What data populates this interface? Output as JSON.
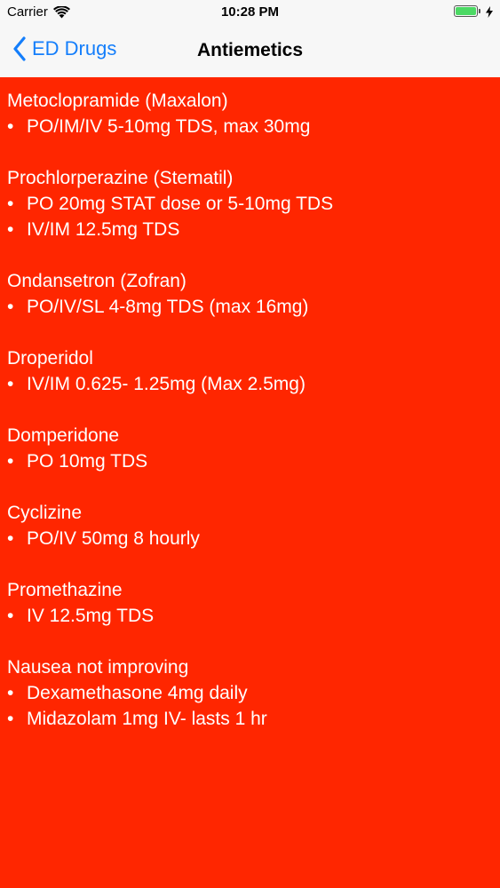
{
  "status_bar": {
    "carrier": "Carrier",
    "time": "10:28 PM",
    "wifi_icon": "wifi-icon",
    "battery_icon": "battery-icon",
    "charging_icon": "bolt-icon",
    "battery_level": 1.0,
    "battery_color": "#4cd964"
  },
  "nav": {
    "back_label": "ED Drugs",
    "back_icon": "chevron-left-icon",
    "title": "Antiemetics",
    "tint_color": "#147efb"
  },
  "background_color": "#ff2600",
  "sections": [
    {
      "name": "Metoclopramide (Maxalon)",
      "doses": [
        "PO/IM/IV 5-10mg TDS, max 30mg"
      ]
    },
    {
      "name": "Prochlorperazine (Stematil)",
      "doses": [
        "PO 20mg STAT dose or 5-10mg TDS",
        "IV/IM 12.5mg TDS"
      ]
    },
    {
      "name": "Ondansetron (Zofran)",
      "doses": [
        "PO/IV/SL 4-8mg TDS (max 16mg)"
      ]
    },
    {
      "name": "Droperidol",
      "doses": [
        "IV/IM 0.625- 1.25mg (Max 2.5mg)"
      ]
    },
    {
      "name": "Domperidone",
      "doses": [
        "PO 10mg TDS"
      ]
    },
    {
      "name": "Cyclizine",
      "doses": [
        "PO/IV 50mg 8 hourly"
      ]
    },
    {
      "name": "Promethazine",
      "doses": [
        "IV 12.5mg TDS"
      ]
    },
    {
      "name": "Nausea not improving",
      "doses": [
        "Dexamethasone 4mg daily",
        "Midazolam 1mg IV- lasts 1 hr"
      ]
    }
  ]
}
